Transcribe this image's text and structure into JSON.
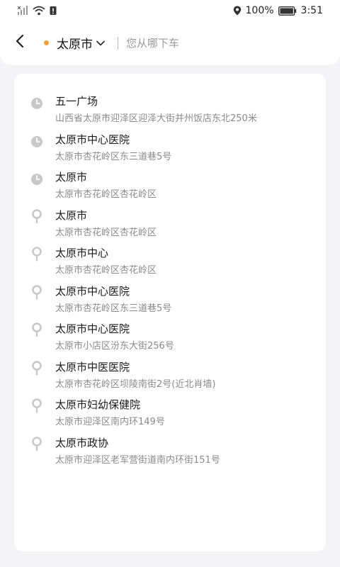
{
  "status_bar": {
    "battery_percent": "100%",
    "time": "3:51",
    "icons": [
      "signal-icon",
      "wifi-icon",
      "alert-icon",
      "location-icon",
      "battery-icon"
    ]
  },
  "header": {
    "city": "太原市",
    "search_placeholder": "您从哪下车",
    "icons": [
      "back-arrow-icon",
      "chevron-down-icon"
    ],
    "accent_color": "#f0a040"
  },
  "results": [
    {
      "type": "history",
      "title": "五一广场",
      "subtitle": "山西省太原市迎泽区迎泽大街并州饭店东北250米"
    },
    {
      "type": "history",
      "title": "太原市中心医院",
      "subtitle": "太原市杏花岭区东三道巷5号"
    },
    {
      "type": "history",
      "title": "太原市",
      "subtitle": "太原市杏花岭区杏花岭区"
    },
    {
      "type": "place",
      "title": "太原市",
      "subtitle": "太原市杏花岭区杏花岭区"
    },
    {
      "type": "place",
      "title": "太原市中心",
      "subtitle": "太原市杏花岭区杏花岭区"
    },
    {
      "type": "place",
      "title": "太原市中心医院",
      "subtitle": "太原市杏花岭区东三道巷5号"
    },
    {
      "type": "place",
      "title": "太原市中心医院",
      "subtitle": "太原市小店区汾东大街256号"
    },
    {
      "type": "place",
      "title": "太原市中医医院",
      "subtitle": "太原市杏花岭区坝陵南街2号(近北肖墙)"
    },
    {
      "type": "place",
      "title": "太原市妇幼保健院",
      "subtitle": "太原市迎泽区南内环149号"
    },
    {
      "type": "place",
      "title": "太原市政协",
      "subtitle": "太原市迎泽区老军营街道南内环街151号"
    }
  ]
}
